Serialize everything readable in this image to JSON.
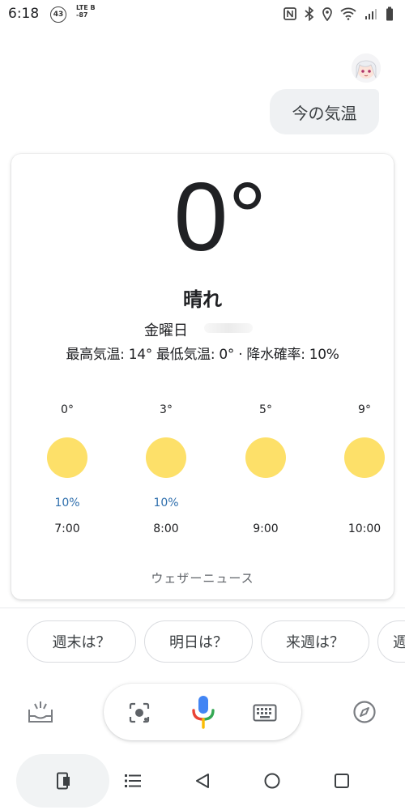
{
  "status_bar": {
    "time": "6:18",
    "notification_count": "43",
    "network_lines": [
      "LTE B",
      "-87"
    ]
  },
  "query": {
    "text": "今の気温"
  },
  "weather": {
    "temperature": "0°",
    "condition": "晴れ",
    "day": "金曜日",
    "details": "最高気温: 14° 最低気温: 0° · 降水確率: 10%",
    "hourly": [
      {
        "temp": "0°",
        "precip": "10%",
        "time": "7:00",
        "icon": "sun-icon"
      },
      {
        "temp": "3°",
        "precip": "10%",
        "time": "8:00",
        "icon": "sun-icon"
      },
      {
        "temp": "5°",
        "precip": "",
        "time": "9:00",
        "icon": "sun-icon"
      },
      {
        "temp": "9°",
        "precip": "",
        "time": "10:00",
        "icon": "sun-icon"
      }
    ],
    "source": "ウェザーニュース",
    "colors": {
      "sun": "#fde069",
      "precip": "#2f6fad"
    }
  },
  "suggestions": [
    "週末は？",
    "明日は？",
    "来週は？",
    "週"
  ],
  "assistant_bar": {
    "icons": [
      "updates-icon",
      "lens-icon",
      "mic-icon",
      "keyboard-icon",
      "explore-icon"
    ]
  },
  "nav_bar": {
    "icons": [
      "phone-icon",
      "list-icon",
      "back-icon",
      "home-icon",
      "recents-icon"
    ]
  }
}
